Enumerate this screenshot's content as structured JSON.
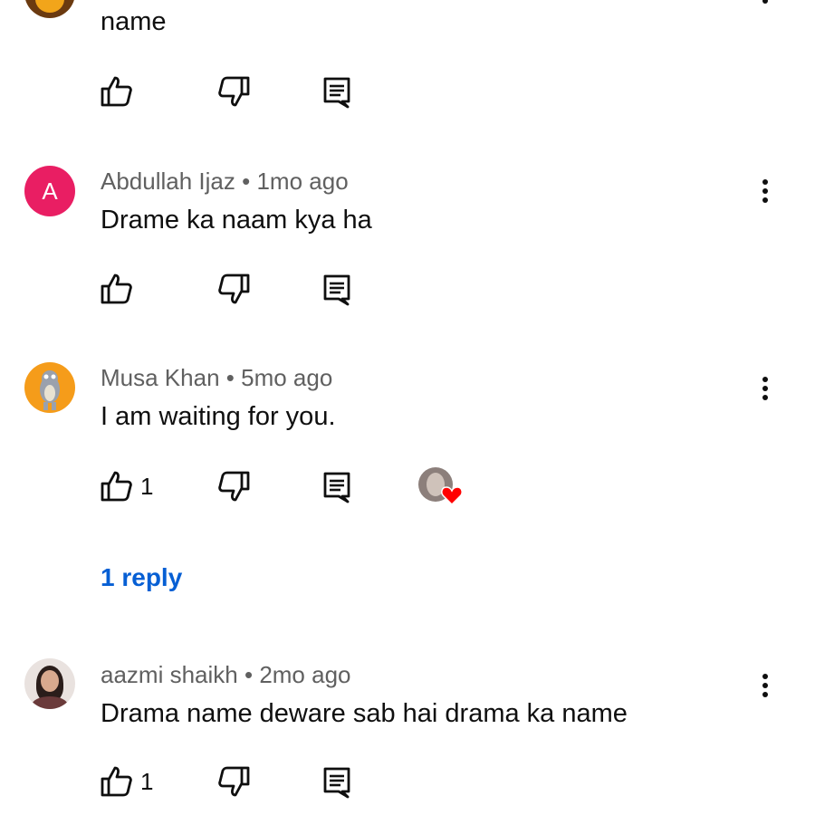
{
  "colors": {
    "link": "#065fd4",
    "meta": "#606060",
    "avatar_pink": "#e91e63",
    "avatar_orange": "#f59c1a",
    "heart": "#ff0000"
  },
  "comments": [
    {
      "text": "name"
    },
    {
      "author": "Abdullah Ijaz",
      "time": "1mo ago",
      "avatar_letter": "A",
      "text": "Drame ka naam kya ha"
    },
    {
      "author": "Musa Khan",
      "time": "5mo ago",
      "text": "I am waiting for you.",
      "likes": "1",
      "replies_label": "1 reply"
    },
    {
      "author": "aazmi shaikh",
      "time": "2mo ago",
      "text": "Drama name deware sab hai drama ka name",
      "likes": "1"
    }
  ],
  "separator": "•",
  "icons": [
    "like-icon",
    "dislike-icon",
    "reply-icon",
    "more-vert-icon",
    "heart-icon"
  ]
}
